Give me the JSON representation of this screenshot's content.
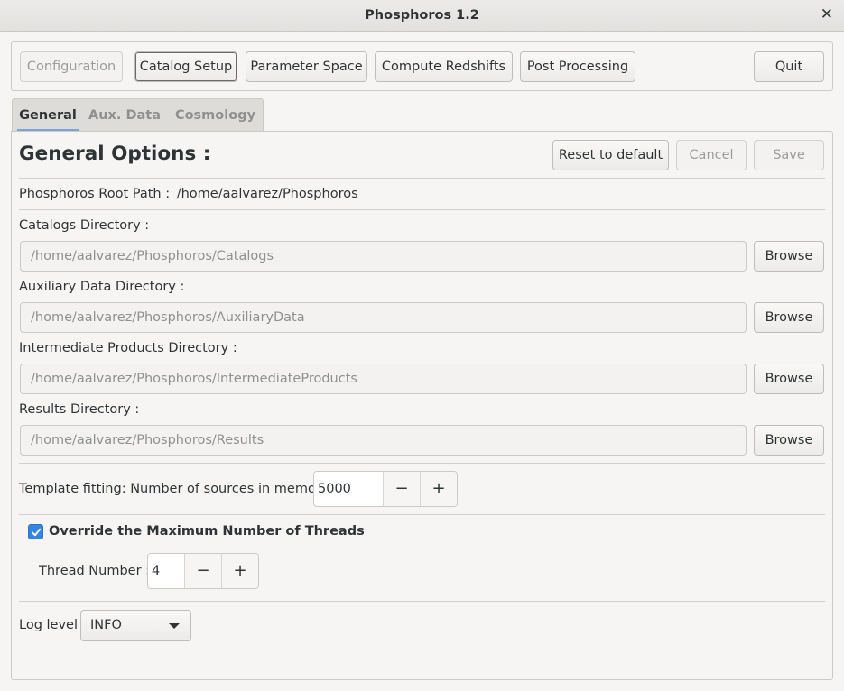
{
  "window": {
    "title": "Phosphoros 1.2",
    "close_icon": "close-icon"
  },
  "toolbar": {
    "configuration": "Configuration",
    "catalog_setup": "Catalog Setup",
    "parameter_space": "Parameter Space",
    "compute_redshifts": "Compute Redshifts",
    "post_processing": "Post Processing",
    "quit": "Quit"
  },
  "tabs": [
    {
      "label": "General",
      "active": true
    },
    {
      "label": "Aux. Data",
      "active": false
    },
    {
      "label": "Cosmology",
      "active": false
    }
  ],
  "general": {
    "heading": "General Options :",
    "reset_label": "Reset to default",
    "cancel_label": "Cancel",
    "save_label": "Save",
    "root_path_label": "Phosphoros Root Path  :",
    "root_path_value": "/home/aalvarez/Phosphoros",
    "directories": [
      {
        "label": "Catalogs Directory :",
        "value": "/home/aalvarez/Phosphoros/Catalogs",
        "button": "Browse"
      },
      {
        "label": "Auxiliary Data Directory :",
        "value": "/home/aalvarez/Phosphoros/AuxiliaryData",
        "button": "Browse"
      },
      {
        "label": "Intermediate Products Directory :",
        "value": "/home/aalvarez/Phosphoros/IntermediateProducts",
        "button": "Browse"
      },
      {
        "label": "Results Directory :",
        "value": "/home/aalvarez/Phosphoros/Results",
        "button": "Browse"
      }
    ],
    "template_fitting_label": "Template fitting:  Number of sources in memory",
    "sources_in_memory": "5000",
    "override_threads_label": "Override the Maximum Number of Threads",
    "override_threads_checked": true,
    "thread_number_label": "Thread Number :",
    "thread_number": "4",
    "log_level_label": "Log level",
    "log_level": "INFO"
  },
  "colors": {
    "accent": "#3584e4",
    "tab_underline": "#7aa3d4"
  }
}
